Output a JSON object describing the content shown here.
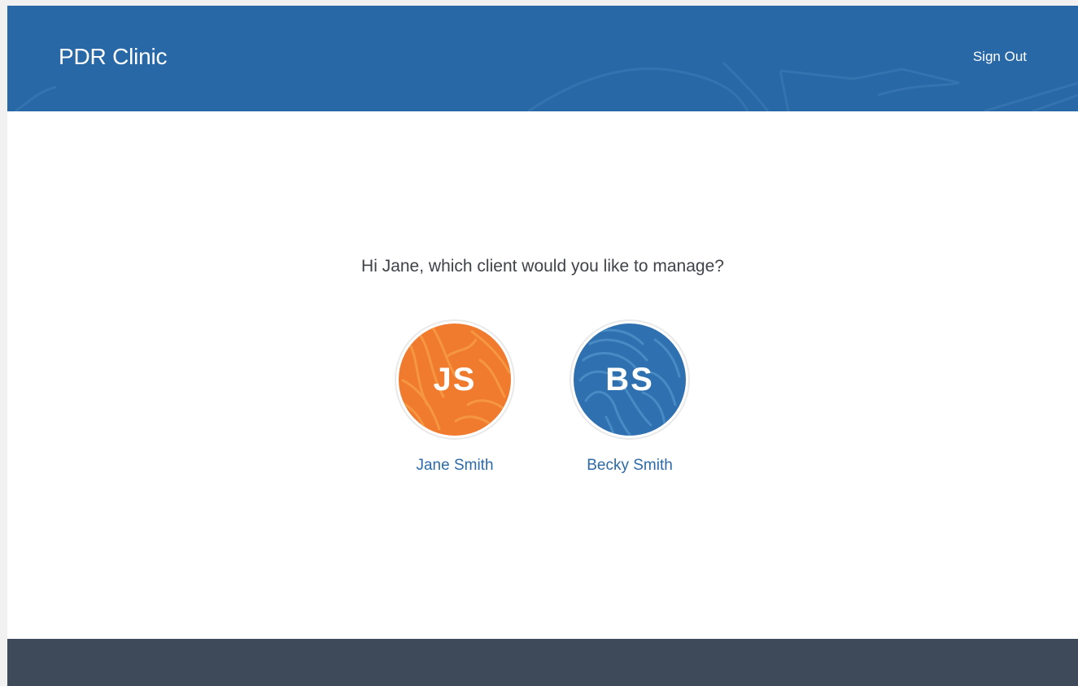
{
  "header": {
    "brand": "PDR Clinic",
    "sign_out_label": "Sign Out"
  },
  "main": {
    "prompt": "Hi Jane, which client would you like to manage?",
    "clients": [
      {
        "initials": "JS",
        "name": "Jane Smith",
        "color": "#f07b2e"
      },
      {
        "initials": "BS",
        "name": "Becky Smith",
        "color": "#2f70b0"
      }
    ]
  },
  "colors": {
    "header_bg": "#2868a6",
    "footer_bg": "#3e4a5a",
    "link": "#2d6aa8"
  }
}
